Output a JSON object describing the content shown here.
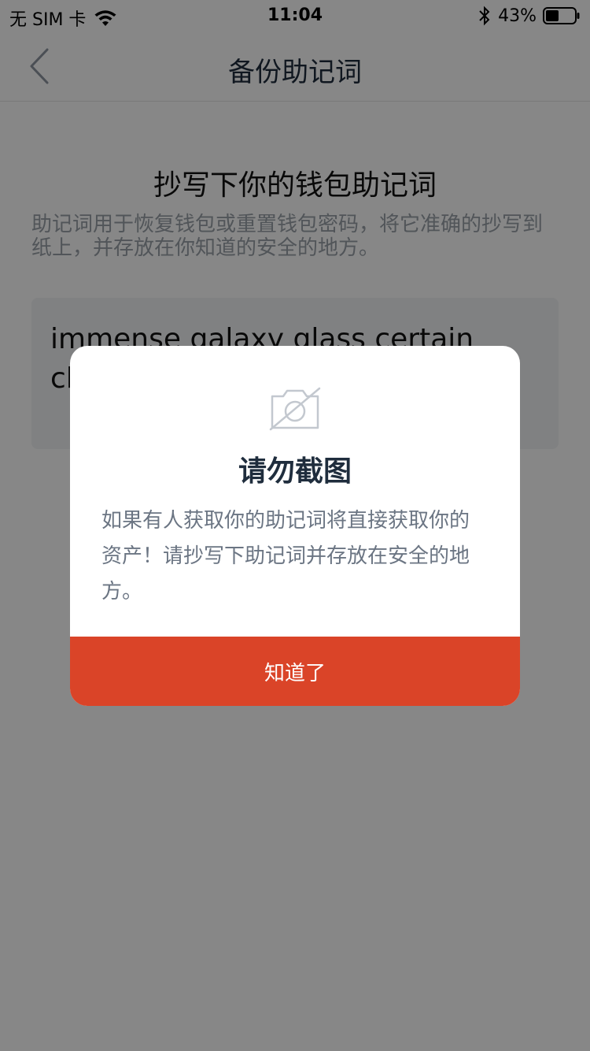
{
  "status_bar": {
    "carrier": "无 SIM 卡",
    "time": "11:04",
    "battery": "43%",
    "icons": [
      "wifi-icon",
      "bluetooth-icon",
      "battery-icon"
    ]
  },
  "nav": {
    "back_icon": "chevron-left-icon",
    "title": "备份助记词"
  },
  "content": {
    "heading": "抄写下你的钱包助记词",
    "description": "助记词用于恢复钱包或重置钱包密码，将它准确的抄写到纸上，并存放在你知道的安全的地方。",
    "mnemonic": "immense galaxy glass certain claw co                              w"
  },
  "modal": {
    "icon": "no-camera-icon",
    "title": "请勿截图",
    "body": "如果有人获取你的助记词将直接获取你的资产！请抄写下助记词并存放在安全的地方。",
    "ok_label": "知道了"
  },
  "colors": {
    "accent": "#da4428",
    "overlay": "rgba(0,0,0,0.47)",
    "title_text": "#1f2d3d",
    "body_text": "#6b7583"
  }
}
